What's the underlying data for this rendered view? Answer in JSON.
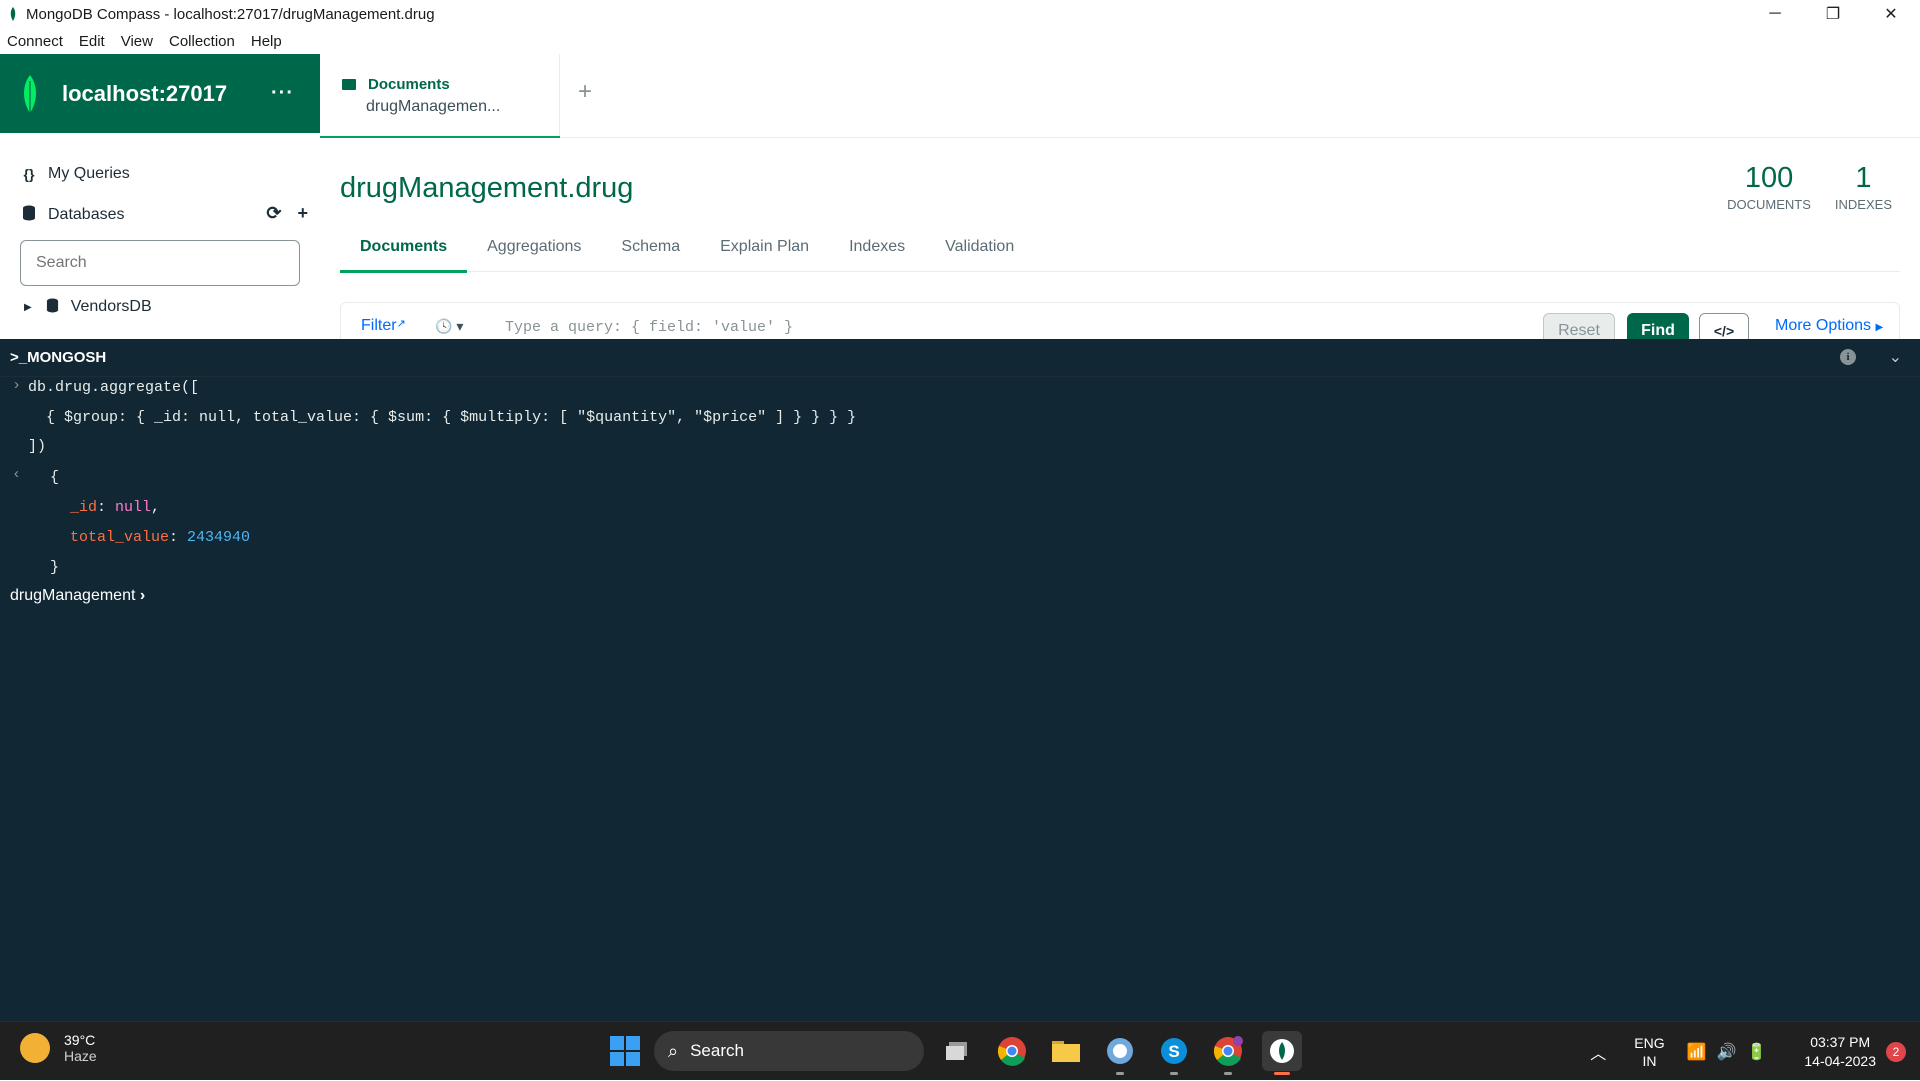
{
  "window": {
    "title": "MongoDB Compass - localhost:27017/drugManagement.drug",
    "minimize": "─",
    "restore": "❐",
    "close": "✕"
  },
  "menu": [
    "Connect",
    "Edit",
    "View",
    "Collection",
    "Help"
  ],
  "sidebar": {
    "host": "localhost:27017",
    "more": "···",
    "my_queries": "My Queries",
    "my_queries_icon": "{}",
    "databases": "Databases",
    "search_placeholder": "Search",
    "databases_list": [
      {
        "name": "VendorsDB"
      }
    ]
  },
  "tab": {
    "title": "Documents",
    "subtitle": "drugManagemen...",
    "add": "+"
  },
  "collection": {
    "db": "drugManagement",
    "sep": ".",
    "name": "drug",
    "documents_count": "100",
    "documents_label": "DOCUMENTS",
    "indexes_count": "1",
    "indexes_label": "INDEXES"
  },
  "subtabs": [
    "Documents",
    "Aggregations",
    "Schema",
    "Explain Plan",
    "Indexes",
    "Validation"
  ],
  "query": {
    "filter_label": "Filter",
    "placeholder": "Type a query: { field: 'value' }",
    "reset": "Reset",
    "find": "Find",
    "code": "</>",
    "more_options": "More Options"
  },
  "shell": {
    "title": ">_MONGOSH",
    "info": "i",
    "lines": {
      "cmd1": "db.drug.aggregate([",
      "cmd2": "  { $group: { _id: null, total_value: { $sum: { $multiply: [ \"$quantity\", \"$price\" ] } } } }",
      "cmd3": "])",
      "open_brace": "{",
      "id_key": "_id",
      "id_val": "null",
      "total_key": "total_value",
      "total_val": "2434940",
      "close_brace": "}",
      "prompt": "drugManagement"
    }
  },
  "taskbar": {
    "temp": "39°C",
    "condition": "Haze",
    "search": "Search",
    "lang1": "ENG",
    "lang2": "IN",
    "time": "03:37 PM",
    "date": "14-04-2023",
    "notifications": "2",
    "colors": {
      "chrome": "#4285f4",
      "skype": "#0a8fd8",
      "mongo": "#00ed64",
      "explorer": "#f7c948"
    }
  }
}
